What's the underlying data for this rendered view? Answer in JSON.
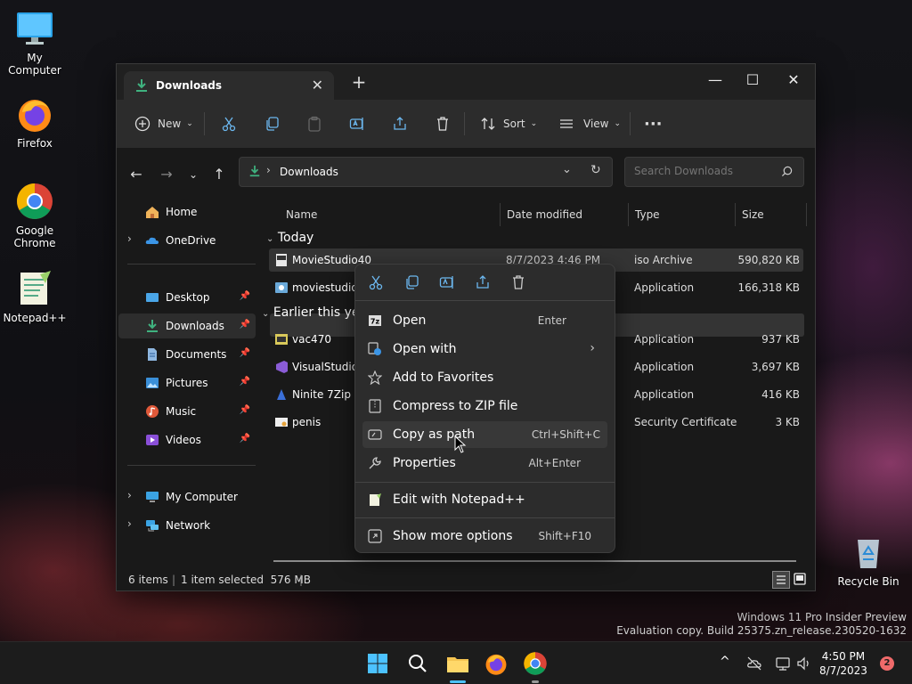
{
  "desktop": {
    "icons": [
      {
        "label": "My Computer"
      },
      {
        "label": "Firefox"
      },
      {
        "label": "Google Chrome"
      },
      {
        "label": "Notepad++"
      },
      {
        "label": "Recycle Bin"
      }
    ],
    "watermark_line1": "Windows 11 Pro Insider Preview",
    "watermark_line2": "Evaluation copy. Build 25375.zn_release.230520-1632"
  },
  "window": {
    "tab_title": "Downloads",
    "toolbar": {
      "new_label": "New",
      "sort_label": "Sort",
      "view_label": "View"
    },
    "address": {
      "path": "Downloads"
    },
    "search": {
      "placeholder": "Search Downloads"
    },
    "nav": {
      "items": [
        {
          "label": "Home",
          "icon": "home-icon"
        },
        {
          "label": "OneDrive",
          "icon": "cloud-icon"
        },
        {
          "label": "Desktop",
          "icon": "desktop-folder-icon"
        },
        {
          "label": "Downloads",
          "icon": "download-icon"
        },
        {
          "label": "Documents",
          "icon": "documents-icon"
        },
        {
          "label": "Pictures",
          "icon": "pictures-icon"
        },
        {
          "label": "Music",
          "icon": "music-icon"
        },
        {
          "label": "Videos",
          "icon": "videos-icon"
        },
        {
          "label": "My Computer",
          "icon": "computer-icon"
        },
        {
          "label": "Network",
          "icon": "network-icon"
        }
      ]
    },
    "columns": {
      "name": "Name",
      "date": "Date modified",
      "type": "Type",
      "size": "Size"
    },
    "groups": {
      "today": "Today",
      "earlier": "Earlier this ye"
    },
    "files": [
      {
        "name": "MovieStudio40",
        "date": "8/7/2023 4:46 PM",
        "type": "iso Archive",
        "size": "590,820 KB"
      },
      {
        "name": "moviestudiop",
        "date": "",
        "type": "Application",
        "size": "166,318 KB"
      },
      {
        "name": "vac470",
        "date": "",
        "type": "Application",
        "size": "937 KB"
      },
      {
        "name": "VisualStudioS",
        "date": "",
        "type": "Application",
        "size": "3,697 KB"
      },
      {
        "name": "Ninite 7Zip C",
        "date": "",
        "type": "Application",
        "size": "416 KB"
      },
      {
        "name": "penis",
        "date": "",
        "type": "Security Certificate",
        "size": "3 KB"
      }
    ],
    "status": {
      "count": "6 items",
      "selection": "1 item selected  576 MB"
    }
  },
  "context_menu": {
    "items": [
      {
        "label": "Open",
        "shortcut": "Enter"
      },
      {
        "label": "Open with",
        "shortcut": ""
      },
      {
        "label": "Add to Favorites",
        "shortcut": ""
      },
      {
        "label": "Compress to ZIP file",
        "shortcut": ""
      },
      {
        "label": "Copy as path",
        "shortcut": "Ctrl+Shift+C"
      },
      {
        "label": "Properties",
        "shortcut": "Alt+Enter"
      },
      {
        "label": "Edit with Notepad++",
        "shortcut": ""
      },
      {
        "label": "Show more options",
        "shortcut": "Shift+F10"
      }
    ]
  },
  "taskbar": {
    "time": "4:50 PM",
    "date": "8/7/2023",
    "notification_count": "2"
  },
  "colors": {
    "accent": "#4cc2ff",
    "download_green": "#3fb27f",
    "selection": "#343434"
  }
}
